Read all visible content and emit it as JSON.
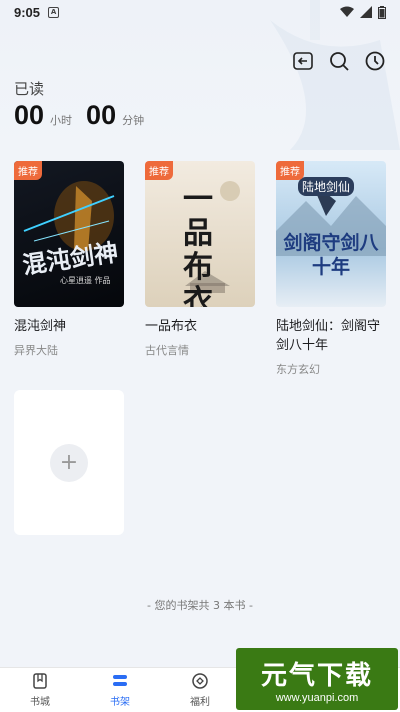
{
  "status_bar": {
    "time": "9:05",
    "app_letter": "A"
  },
  "header": {
    "reading_label": "已读",
    "hours": "00",
    "hours_unit": "小时",
    "minutes": "00",
    "minutes_unit": "分钟"
  },
  "books": [
    {
      "badge": "推荐",
      "title": "混沌剑神",
      "genre": "异界大陆",
      "cover_text": "混沌剑神",
      "cover_sub": "心星逍遥 作品",
      "cover_colors": [
        "#0b0e14",
        "#1c2230"
      ]
    },
    {
      "badge": "推荐",
      "title": "一品布衣",
      "genre": "古代言情",
      "cover_text": "一品布衣",
      "cover_sub": "",
      "cover_colors": [
        "#efe7da",
        "#d9cdb6"
      ]
    },
    {
      "badge": "推荐",
      "title": "陆地剑仙：剑阁守剑八十年",
      "genre": "东方玄幻",
      "cover_text": "剑阁守剑八十年",
      "cover_sub": "陆地剑仙",
      "cover_colors": [
        "#cfe4f5",
        "#8fb8d8"
      ]
    }
  ],
  "shelf_count": "- 您的书架共 3 本书 -",
  "bottom_nav": [
    {
      "label": "书城",
      "icon": "book-icon",
      "active": false
    },
    {
      "label": "书架",
      "icon": "shelf-icon",
      "active": true
    },
    {
      "label": "福利",
      "icon": "gift-icon",
      "active": false
    }
  ],
  "watermark": {
    "big": "元气下载",
    "small": "www.yuanpi.com"
  },
  "colors": {
    "accent": "#2a6df4",
    "badge": "#ee6a3b"
  }
}
